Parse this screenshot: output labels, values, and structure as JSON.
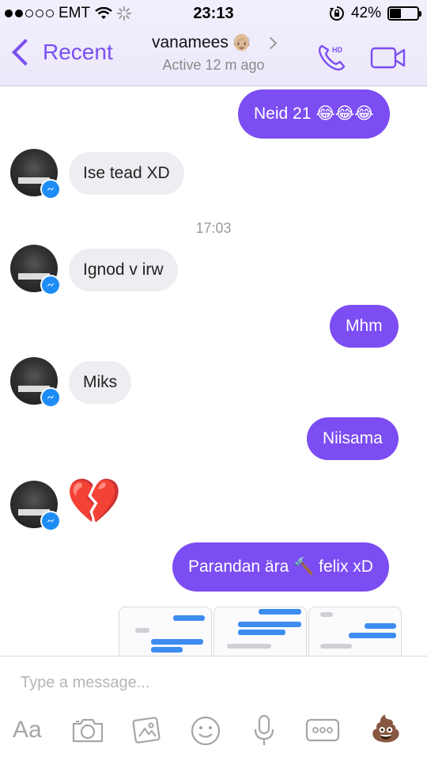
{
  "status_bar": {
    "carrier": "EMT",
    "time": "23:13",
    "battery_percent": "42%",
    "battery_level": 0.42
  },
  "nav": {
    "back_label": "Recent",
    "title": "vanamees",
    "title_emoji": "👴🏼",
    "subtitle": "Active 12 m ago",
    "hd_label": "HD"
  },
  "messages": [
    {
      "dir": "out",
      "text": "Neid 21",
      "emoji": "😂😂😂"
    },
    {
      "dir": "in",
      "text": "Ise tead XD"
    },
    {
      "dir": "time",
      "text": "17:03"
    },
    {
      "dir": "in",
      "text": "Ignod v irw"
    },
    {
      "dir": "out",
      "text": "Mhm"
    },
    {
      "dir": "in",
      "text": "Miks"
    },
    {
      "dir": "out",
      "text": "Niisama"
    },
    {
      "dir": "in",
      "emoji": "💔"
    },
    {
      "dir": "out",
      "text_before": "Parandan ära",
      "emoji": "🔨",
      "text_after": "felix xD"
    }
  ],
  "avatar_shirt_text": "ΞΞΞ",
  "composer": {
    "placeholder": "Type a message...",
    "aa_label": "Aa",
    "emoji_poop": "💩"
  },
  "icons": {
    "back": "chevron-left-icon",
    "call": "phone-hd-icon",
    "video": "video-camera-icon",
    "camera": "camera-icon",
    "gallery": "gallery-icon",
    "emoji": "smiley-icon",
    "mic": "microphone-icon",
    "more": "more-icon"
  },
  "colors": {
    "accent": "#7b4df2",
    "incoming_bubble": "#efedf1",
    "messenger_badge": "#1e8cf5"
  }
}
